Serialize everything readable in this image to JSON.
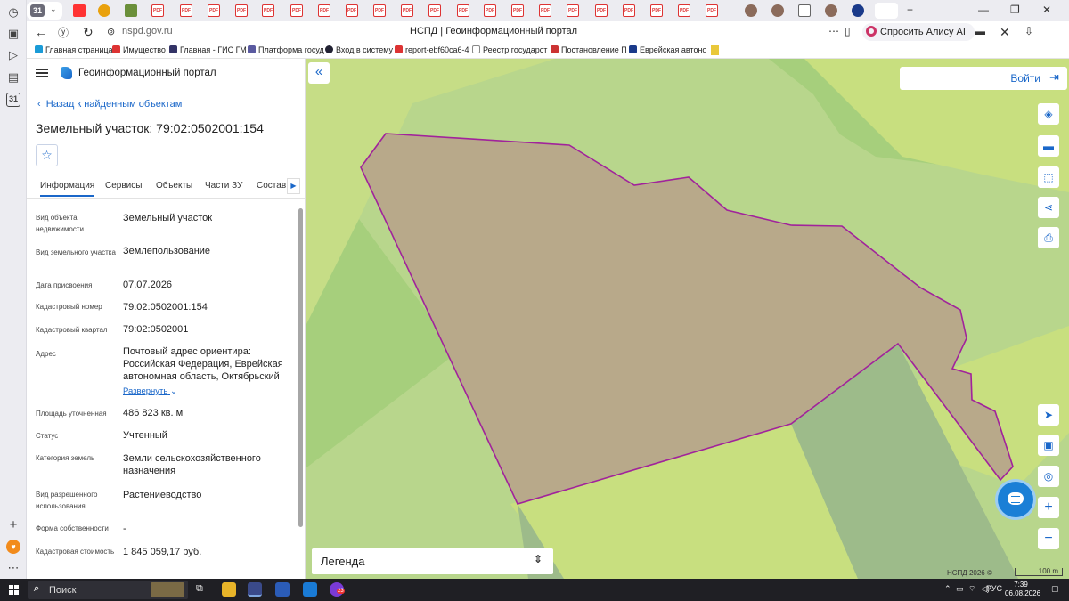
{
  "browser": {
    "tab_count_badge": "31",
    "url": "nspd.gov.ru",
    "page_title": "НСПД | Геоинформационный портал",
    "alice_label": "Спросить Алису AI",
    "pdf_tab_label": "PDF",
    "bookmarks": [
      "Главная страница",
      "Имущество",
      "Главная - ГИС ГМ",
      "Платформа госуд",
      "Вход в систему",
      "report-ebf60ca6-4",
      "Реестр государст",
      "Постановление П",
      "Еврейская автоно"
    ]
  },
  "app": {
    "name": "Геоинформационный портал",
    "back_link": "Назад к найденным объектам",
    "title": "Земельный участок: 79:02:0502001:154",
    "tabs": [
      "Информация",
      "Сервисы",
      "Объекты",
      "Части ЗУ",
      "Состав"
    ],
    "expand_label": "Развернуть",
    "properties": [
      {
        "label": "Вид объекта недвижимости",
        "value": "Земельный участок"
      },
      {
        "label": "Вид земельного участка",
        "value": "Землепользование"
      },
      {
        "label": "Дата присвоения",
        "value": "07.07.2026"
      },
      {
        "label": "Кадастровый номер",
        "value": "79:02:0502001:154"
      },
      {
        "label": "Кадастровый квартал",
        "value": "79:02:0502001"
      },
      {
        "label": "Адрес",
        "value": "Почтовый адрес ориентира: Российская Федерация, Еврейская автономная область, Октябрьский"
      },
      {
        "label": "Площадь уточненная",
        "value": "486 823 кв. м"
      },
      {
        "label": "Статус",
        "value": "Учтенный"
      },
      {
        "label": "Категория земель",
        "value": "Земли сельскохозяйственного назначения"
      },
      {
        "label": "Вид разрешенного использования",
        "value": "Растениеводство"
      },
      {
        "label": "Форма собственности",
        "value": "-"
      },
      {
        "label": "Кадастровая стоимость",
        "value": "1 845 059,17 руб."
      }
    ]
  },
  "map": {
    "login_label": "Войти",
    "legend_label": "Легенда",
    "copyright": "НСПД 2026 ©",
    "scale_label": "100 m",
    "parcel_stroke": "#a1239b",
    "parcel_fill": "#b8a98a"
  },
  "taskbar": {
    "search_label": "Поиск",
    "lang": "РУС",
    "time": "7:39",
    "date": "06.08.2026",
    "badge": "23"
  },
  "colors": {
    "accent": "#1a67c9",
    "map_green": "#b8d68c"
  }
}
